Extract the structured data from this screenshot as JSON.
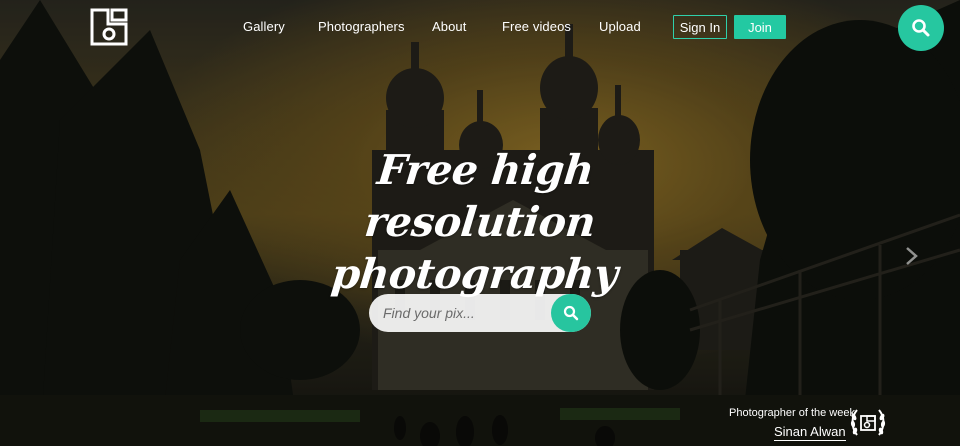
{
  "nav": {
    "links": [
      "Gallery",
      "Photographers",
      "About",
      "Free videos",
      "Upload"
    ],
    "signin_label": "Sign In",
    "join_label": "Join",
    "logo_icon": "logo-icon",
    "search_icon": "search-icon"
  },
  "hero": {
    "headline_line1": "Free high resolution",
    "headline_line2": "photography",
    "search": {
      "placeholder": "Find your pix..."
    },
    "next_icon": "chevron-right-icon"
  },
  "photographer_of_week": {
    "label": "Photographer of the week",
    "name": "Sinan Alwan",
    "badge_icon": "laurel-badge-icon"
  },
  "colors": {
    "accent": "#26c7a0",
    "text": "#ffffff"
  }
}
